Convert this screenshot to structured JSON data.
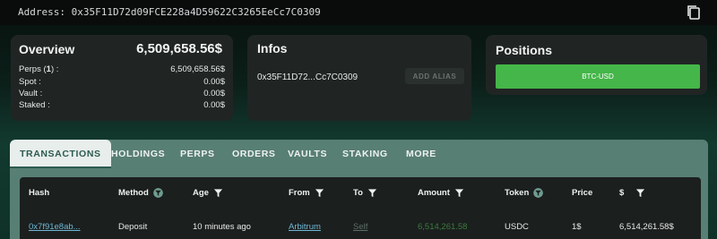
{
  "address_bar": {
    "text": "Address: 0x35F11D72d09FCE228a4D59622C3265EeCc7C0309",
    "copy_icon": "copy-icon"
  },
  "overview": {
    "title": "Overview",
    "total": "6,509,658.56$",
    "rows": [
      {
        "label": "Perps",
        "count": "1",
        "value": "6,509,658.56$"
      },
      {
        "label": "Spot :",
        "value": "0.00$"
      },
      {
        "label": "Vault :",
        "value": "0.00$"
      },
      {
        "label": "Staked :",
        "value": "0.00$"
      }
    ]
  },
  "infos": {
    "title": "Infos",
    "short_address": "0x35F11D72...Cc7C0309",
    "add_alias_label": "ADD ALIAS"
  },
  "positions": {
    "title": "Positions",
    "items": [
      "BTC-USD"
    ],
    "button_color": "#45b649"
  },
  "tabs": [
    "TRANSACTIONS",
    "HOLDINGS",
    "PERPS",
    "ORDERS",
    "VAULTS",
    "STAKING",
    "MORE"
  ],
  "active_tab": "TRANSACTIONS",
  "table": {
    "columns": [
      "Hash",
      "Method",
      "Age",
      "From",
      "To",
      "Amount",
      "Token",
      "Price",
      "$"
    ],
    "filter_icon": "filter-icon",
    "rows": [
      {
        "hash": "0x7f91e8ab...",
        "method": "Deposit",
        "age": "10 minutes ago",
        "from": "Arbitrum",
        "to": "Self",
        "amount": "6,514,261.58",
        "token": "USDC",
        "price": "1$",
        "usd": "6,514,261.58$"
      }
    ]
  },
  "colors": {
    "accent_green": "#45b649",
    "panel_teal": "#587f74",
    "link_blue": "#6fb8d6"
  }
}
